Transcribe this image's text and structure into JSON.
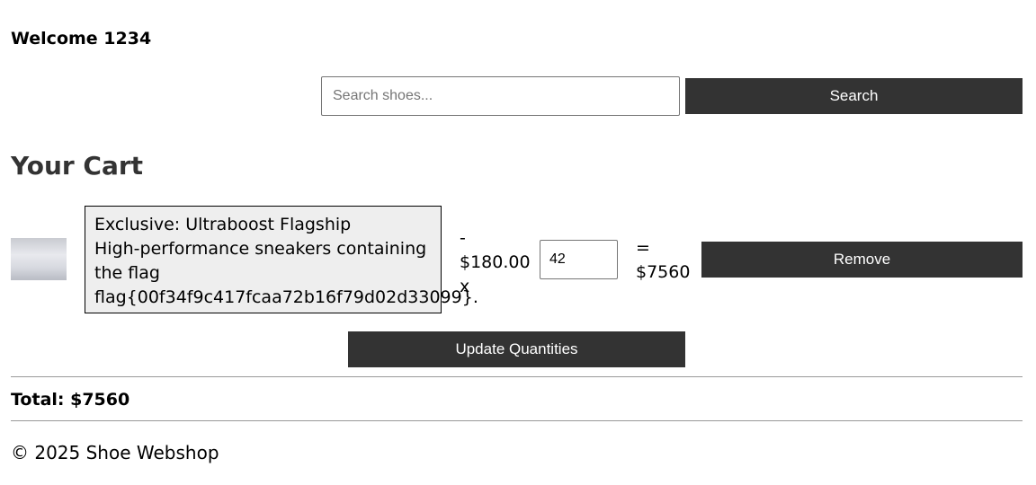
{
  "header": {
    "welcome": "Welcome 1234"
  },
  "search": {
    "placeholder": "Search shoes...",
    "value": "",
    "button_label": "Search"
  },
  "cart": {
    "title": "Your Cart",
    "items": [
      {
        "description_lines": [
          "Exclusive: Ultraboost Flagship",
          "High-performance sneakers containing",
          "the flag",
          "flag{00f34f9c417fcaa72b16f79d02d33099}."
        ],
        "price_prefix": "-",
        "price": "$180.00",
        "price_suffix": "x",
        "quantity": "42",
        "equals": "=",
        "line_total": "$7560",
        "remove_label": "Remove"
      }
    ],
    "update_label": "Update Quantities",
    "total_text": "Total: $7560"
  },
  "footer": {
    "text": "© 2025 Shoe Webshop"
  },
  "colors": {
    "button_bg": "#333333",
    "button_text": "#ffffff",
    "heading": "#333333",
    "description_bg": "#eeeeee"
  }
}
